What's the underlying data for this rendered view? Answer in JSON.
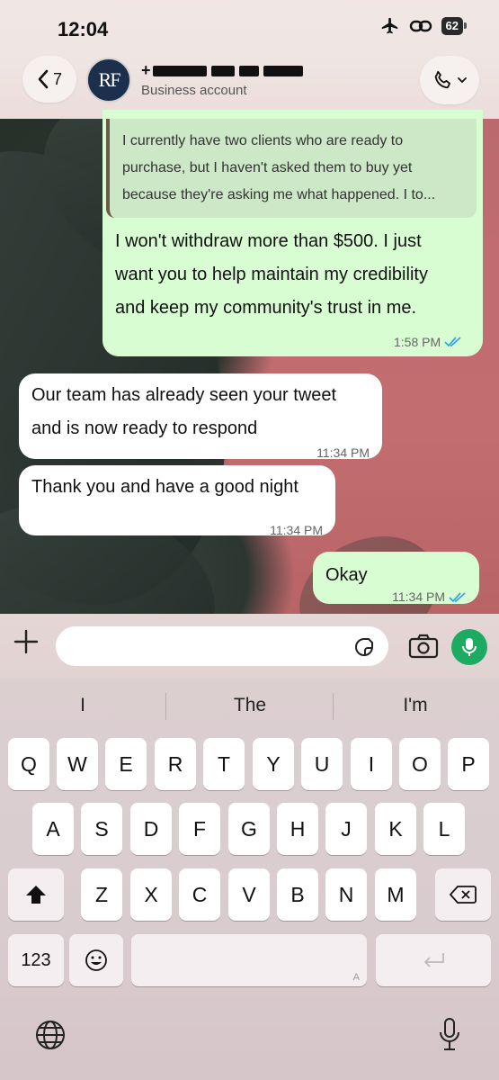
{
  "status_bar": {
    "time": "12:04",
    "battery": "62"
  },
  "header": {
    "back_count": "7",
    "avatar_initials": "RF",
    "contact_prefix": "+",
    "contact_subtitle": "Business account"
  },
  "messages": [
    {
      "direction": "out",
      "quoted": "I currently have two clients who are ready to purchase, but I haven't asked them to buy yet because they're asking me what happened. I to...",
      "lines": [
        "I won't withdraw more than $500. I just",
        "want you to help maintain my credibility",
        "and keep my community's trust in me."
      ],
      "time": "1:58 PM",
      "status": "read"
    },
    {
      "direction": "in",
      "lines": [
        "Our team has already seen your tweet",
        "and is now ready to respond"
      ],
      "time": "11:34 PM"
    },
    {
      "direction": "in",
      "lines": [
        "Thank you and have a good night"
      ],
      "time": "11:34 PM"
    },
    {
      "direction": "out",
      "lines": [
        "Okay"
      ],
      "time": "11:34 PM",
      "status": "read"
    }
  ],
  "input": {
    "placeholder": ""
  },
  "keyboard": {
    "suggestions": [
      "I",
      "The",
      "I'm"
    ],
    "row1": [
      "Q",
      "W",
      "E",
      "R",
      "T",
      "Y",
      "U",
      "I",
      "O",
      "P"
    ],
    "row2": [
      "A",
      "S",
      "D",
      "F",
      "G",
      "H",
      "J",
      "K",
      "L"
    ],
    "row3": [
      "Z",
      "X",
      "C",
      "V",
      "B",
      "N",
      "M"
    ],
    "numbers_label": "123",
    "space_hint": "A"
  },
  "colors": {
    "outgoing_bubble": "#d9fdd3",
    "incoming_bubble": "#ffffff",
    "read_ticks": "#34a3e0",
    "mic_button": "#1daa61"
  },
  "icons": [
    "airplane-icon",
    "link-icon",
    "back-chevron-icon",
    "phone-icon",
    "chevron-down-icon",
    "plus-icon",
    "sticker-icon",
    "camera-icon",
    "mic-icon",
    "shift-icon",
    "backspace-icon",
    "emoji-icon",
    "return-icon",
    "globe-icon",
    "dictation-icon"
  ]
}
